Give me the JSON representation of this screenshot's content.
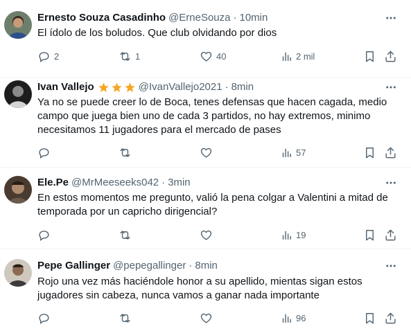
{
  "tweets": [
    {
      "name": "Ernesto Souza Casadinho",
      "handle": "@ErneSouza",
      "time": "10min",
      "text": "El ídolo de los boludos. Que club olvidando por dios",
      "replies": "2",
      "retweets": "1",
      "likes": "40",
      "views": "2 mil",
      "has_stars": false
    },
    {
      "name": "Ivan Vallejo",
      "handle": "@IvanVallejo2021",
      "time": "8min",
      "text": "Ya no se puede creer lo de Boca, tenes defensas que hacen cagada, medio campo que juega bien uno de cada 3 partidos, no hay extremos, minimo necesitamos 11 jugadores para el mercado de pases",
      "replies": "",
      "retweets": "",
      "likes": "",
      "views": "57",
      "has_stars": true,
      "star_color": "#f6a623"
    },
    {
      "name": "Ele.Pe",
      "handle": "@MrMeeseeks042",
      "time": "3min",
      "text": "En estos momentos me pregunto, valió la pena colgar a Valentini a mitad de temporada por un capricho dirigencial?",
      "replies": "",
      "retweets": "",
      "likes": "",
      "views": "19",
      "has_stars": false
    },
    {
      "name": "Pepe Gallinger",
      "handle": "@pepegallinger",
      "time": "8min",
      "text": "Rojo una vez más haciéndole honor a su apellido, mientas sigan estos jugadores sin cabeza, nunca vamos a ganar nada importante",
      "replies": "",
      "retweets": "",
      "likes": "",
      "views": "96",
      "has_stars": false
    }
  ],
  "separator": "·",
  "colors": {
    "text_primary": "#0f1419",
    "text_secondary": "#536471",
    "divider": "#eff3f4"
  }
}
